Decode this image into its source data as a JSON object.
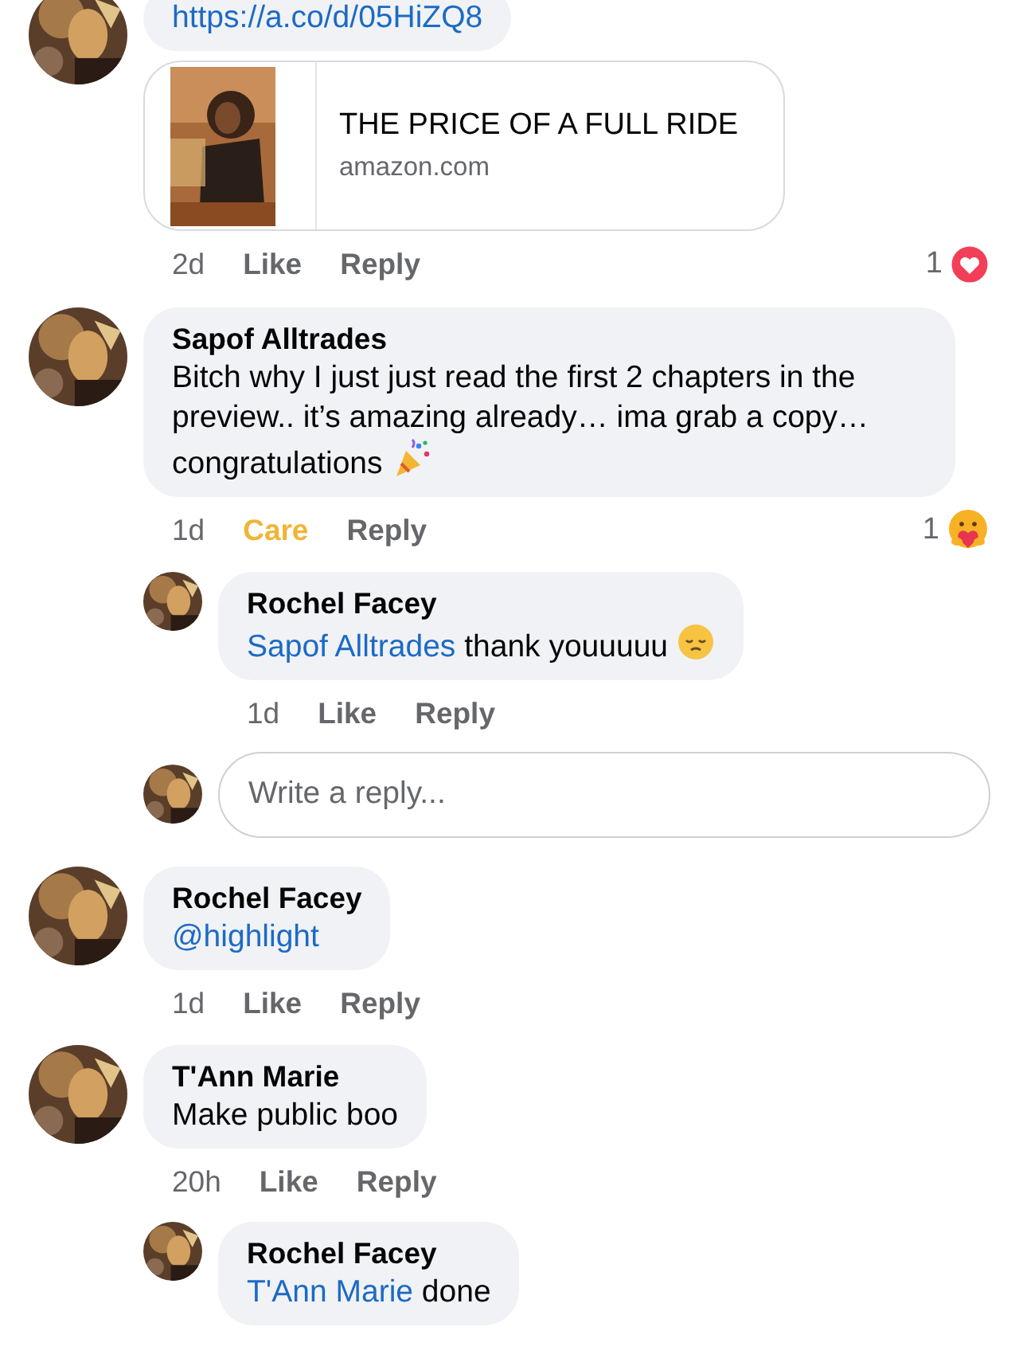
{
  "comments": [
    {
      "kind": "comment",
      "parts": [
        {
          "kind": "link",
          "text": "https://a.co/d/05HiZQ8"
        }
      ],
      "preview": {
        "title": "THE PRICE OF A FULL RIDE",
        "domain": "amazon.com"
      },
      "time": "2d",
      "like": {
        "label": "Like",
        "selected": false
      },
      "reply": "Reply",
      "reactions": {
        "count": "1",
        "kind": "love"
      }
    },
    {
      "kind": "comment",
      "author": "Sapof Alltrades",
      "parts": [
        {
          "kind": "plain",
          "text": "Bitch why I just just read the first 2 chapters in the preview.. it’s amazing already… ima grab a copy… congratulations "
        },
        {
          "kind": "party"
        }
      ],
      "time": "1d",
      "like": {
        "label": "Care",
        "selected": true
      },
      "reply": "Reply",
      "reactions": {
        "count": "1",
        "kind": "care"
      }
    },
    {
      "kind": "reply",
      "author": "Rochel Facey",
      "parts": [
        {
          "kind": "mention",
          "text": "Sapof Alltrades"
        },
        {
          "kind": "plain",
          "text": " thank youuuuu "
        },
        {
          "kind": "pensive"
        }
      ],
      "time": "1d",
      "like": {
        "label": "Like",
        "selected": false
      },
      "reply": "Reply"
    },
    {
      "kind": "input",
      "placeholder": "Write a reply..."
    },
    {
      "kind": "comment",
      "author": "Rochel Facey",
      "parts": [
        {
          "kind": "mention",
          "text": "@highlight"
        }
      ],
      "time": "1d",
      "like": {
        "label": "Like",
        "selected": false
      },
      "reply": "Reply"
    },
    {
      "kind": "comment",
      "author": "T'Ann Marie",
      "parts": [
        {
          "kind": "plain",
          "text": "Make public boo"
        }
      ],
      "time": "20h",
      "like": {
        "label": "Like",
        "selected": false
      },
      "reply": "Reply"
    },
    {
      "kind": "reply",
      "author": "Rochel Facey",
      "parts": [
        {
          "kind": "mention",
          "text": "T'Ann Marie"
        },
        {
          "kind": "plain",
          "text": " done"
        }
      ]
    }
  ]
}
